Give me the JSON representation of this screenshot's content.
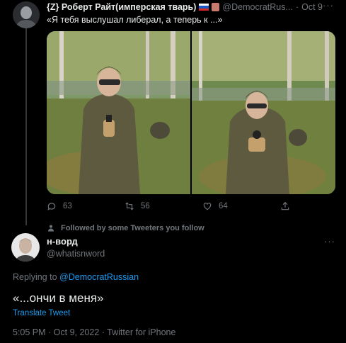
{
  "original_tweet": {
    "display_name": "{Z} Роберт Райт(имперская тварь)",
    "handle": "@DemocratRus...",
    "separator": "·",
    "date": "Oct 9",
    "text": "«Я тебя выслушал либерал, а теперь к ...»",
    "more_icon": "more-dots-icon",
    "photos": [
      "left-photo",
      "right-photo"
    ],
    "actions": {
      "replies": "63",
      "retweets": "56",
      "likes": "64"
    }
  },
  "social_context": {
    "text": "Followed by some Tweeters you follow"
  },
  "reply_tweet": {
    "display_name": "н-ворд",
    "handle": "@whatisnword",
    "replying_prefix": "Replying to",
    "replying_to": "@DemocratRussian",
    "text": "«...ончи в меня»",
    "translate_label": "Translate Tweet",
    "timestamp": "5:05 PM · Oct 9, 2022 · Twitter for iPhone"
  },
  "colors": {
    "background": "#000000",
    "primary_text": "#e7e9ea",
    "secondary_text": "#71767b",
    "accent": "#1d9bf0"
  }
}
